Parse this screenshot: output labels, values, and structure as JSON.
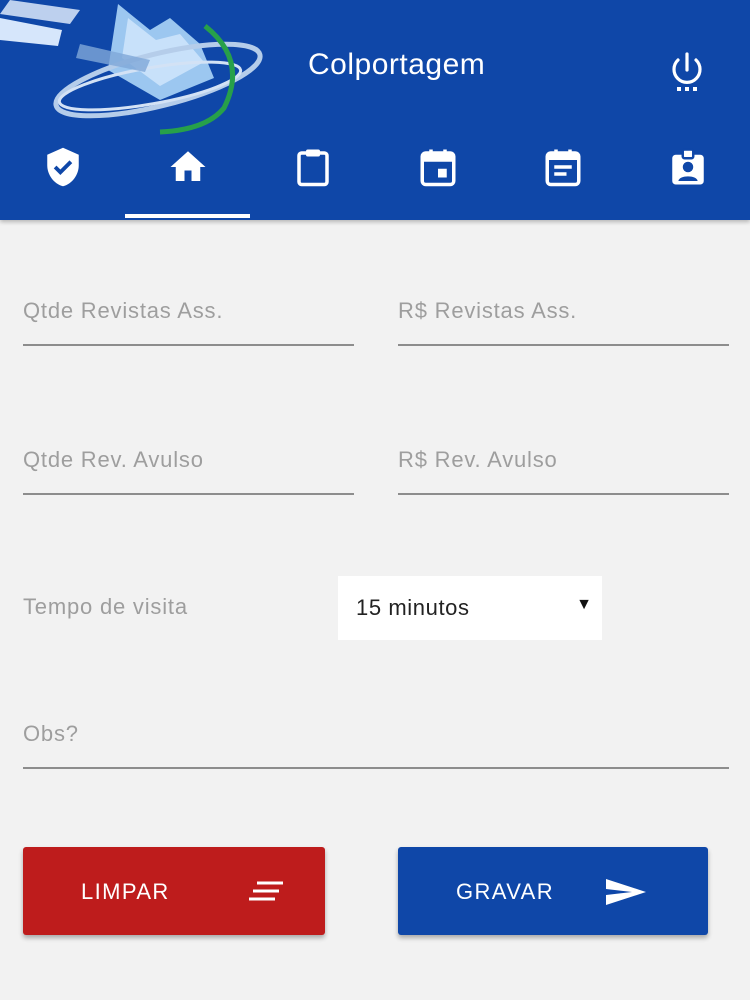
{
  "header": {
    "title": "Colportagem",
    "logo_icon": "app-logo",
    "power_icon": "power-icon",
    "background_color": "#0f47a8"
  },
  "tabs": [
    {
      "icon": "verified-shield-icon",
      "active": false
    },
    {
      "icon": "home-icon",
      "active": true
    },
    {
      "icon": "clipboard-icon",
      "active": false
    },
    {
      "icon": "calendar-event-icon",
      "active": false
    },
    {
      "icon": "event-note-icon",
      "active": false
    },
    {
      "icon": "contact-badge-icon",
      "active": false
    }
  ],
  "form": {
    "qtde_revistas_ass": {
      "placeholder": "Qtde Revistas Ass.",
      "value": ""
    },
    "rs_revistas_ass": {
      "placeholder": "R$ Revistas Ass.",
      "value": ""
    },
    "qtde_rev_avulso": {
      "placeholder": "Qtde Rev. Avulso",
      "value": ""
    },
    "rs_rev_avulso": {
      "placeholder": "R$ Rev. Avulso",
      "value": ""
    },
    "tempo_visita_label": "Tempo de visita",
    "tempo_visita_selected": "15 minutos",
    "obs": {
      "placeholder": "Obs?",
      "value": ""
    }
  },
  "buttons": {
    "limpar": {
      "label": "LIMPAR",
      "icon": "clear-lines-icon",
      "color": "#be1c1c"
    },
    "gravar": {
      "label": "GRAVAR",
      "icon": "send-icon",
      "color": "#0f47a8"
    }
  }
}
